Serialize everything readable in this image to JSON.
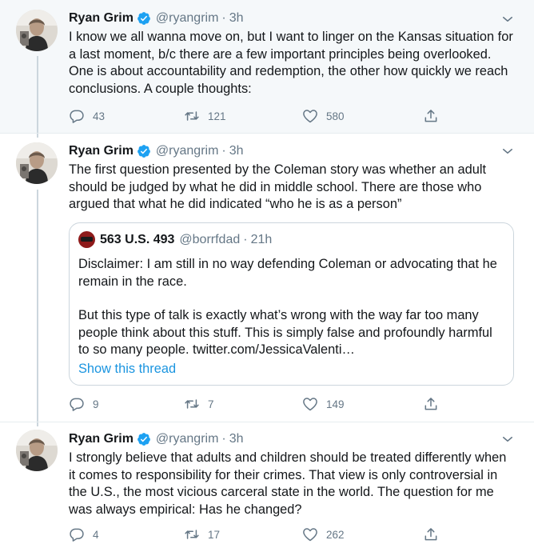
{
  "tweets": [
    {
      "author": {
        "name": "Ryan Grim",
        "handle": "@ryangrim",
        "verified": true
      },
      "time": "3h",
      "text": [
        "I know we all wanna move on, but I want to linger on the Kansas situation for",
        "a last moment, b/c there are a few important principles being overlooked.",
        "One is about accountability and redemption, the other how quickly we reach",
        "conclusions. A couple thoughts:"
      ],
      "stats": {
        "replies": "43",
        "retweets": "121",
        "likes": "580"
      }
    },
    {
      "author": {
        "name": "Ryan Grim",
        "handle": "@ryangrim",
        "verified": true
      },
      "time": "3h",
      "text": [
        "The first question presented by the Coleman story was whether an adult",
        "should be judged by what he did in middle school. There are those who",
        "argued that what he did indicated “who he is as a person”"
      ],
      "quoted": {
        "author": {
          "name": "563 U.S. 493",
          "handle": "@borrfdad"
        },
        "time": "21h",
        "text": [
          "Disclaimer: I am still in no way defending Coleman or advocating that he",
          "remain in the race.",
          "But this type of talk is exactly what’s wrong with the way far too many",
          "people think about this stuff. This is simply false and profoundly harmful",
          "to so many people. twitter.com/JessicaValenti…"
        ],
        "show_thread": "Show this thread"
      },
      "stats": {
        "replies": "9",
        "retweets": "7",
        "likes": "149"
      }
    },
    {
      "author": {
        "name": "Ryan Grim",
        "handle": "@ryangrim",
        "verified": true
      },
      "time": "3h",
      "text": [
        "I strongly believe that adults and children should be treated differently when",
        "it comes to responsibility for their crimes. That view is only controversial in",
        "the U.S., the most vicious carceral state in the world. The question for me",
        "was always empirical: Has he changed?"
      ],
      "stats": {
        "replies": "4",
        "retweets": "17",
        "likes": "262"
      }
    }
  ],
  "colors": {
    "accent": "#1b95e0",
    "muted": "#657786",
    "border": "#ccd6dd",
    "highlight_bg": "#f5f8fa"
  },
  "icons": [
    "verified-badge-icon",
    "chevron-down-icon",
    "reply-icon",
    "retweet-icon",
    "like-icon",
    "share-icon"
  ]
}
